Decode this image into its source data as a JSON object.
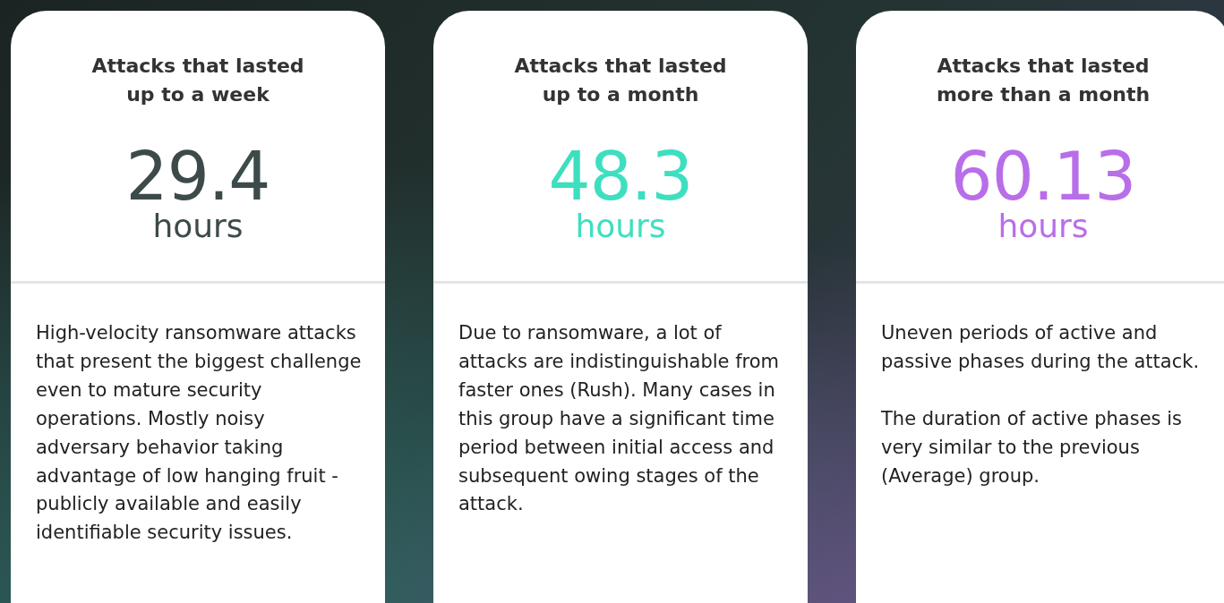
{
  "cards": [
    {
      "title": "Attacks that lasted up to a week",
      "value": "29.4",
      "unit": "hours",
      "color": "#3d4a4a",
      "paragraphs": [
        "High-velocity ransomware attacks that present the biggest challenge even to mature security operations. Mostly noisy adversary behavior taking advantage of low hanging fruit - publicly available and easily identifiable security issues."
      ]
    },
    {
      "title": "Attacks that lasted up to a month",
      "value": "48.3",
      "unit": "hours",
      "color": "#3ddfbf",
      "paragraphs": [
        "Due to ransomware, a lot of attacks are indistinguishable from faster ones (Rush). Many cases in this group have a significant time period between initial access and subsequent owing stages of the attack."
      ]
    },
    {
      "title": "Attacks that lasted more than a month",
      "value": "60.13",
      "unit": "hours",
      "color": "#b96ee9",
      "paragraphs": [
        "Uneven periods of active and passive phases during the attack.",
        "The duration of active phases is very similar to the previous (Average) group."
      ]
    }
  ]
}
